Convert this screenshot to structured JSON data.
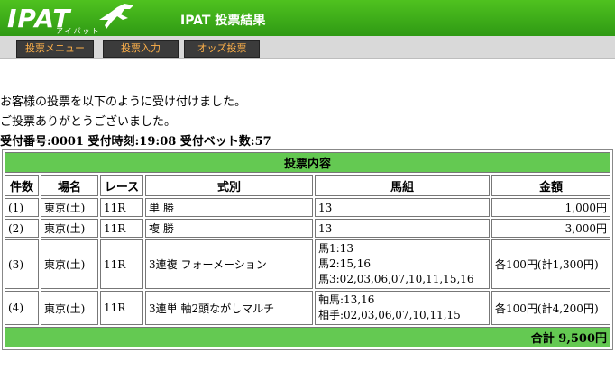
{
  "header": {
    "logo_text": "IPAT",
    "logo_sub": "アイパット",
    "title": "IPAT  投票結果"
  },
  "nav": [
    {
      "label": "投票メニュー"
    },
    {
      "label": "投票入力"
    },
    {
      "label": "オッズ投票"
    }
  ],
  "message": {
    "line1": "お客様の投票を以下のように受け付けました。",
    "line2": "ご投票ありがとうございました。",
    "receipt": "受付番号:0001  受付時刻:19:08  受付ベット数:57"
  },
  "table": {
    "caption": "投票内容",
    "headers": [
      "件数",
      "場名",
      "レース",
      "式別",
      "馬組",
      "金額"
    ],
    "rows": [
      {
        "no": "(1)",
        "venue": "東京(土)",
        "race": "11R",
        "type": "単  勝",
        "combo": [
          "13"
        ],
        "amount": "1,000円"
      },
      {
        "no": "(2)",
        "venue": "東京(土)",
        "race": "11R",
        "type": "複  勝",
        "combo": [
          "13"
        ],
        "amount": "3,000円"
      },
      {
        "no": "(3)",
        "venue": "東京(土)",
        "race": "11R",
        "type": "3連複  フォーメーション",
        "combo": [
          "馬1:13",
          "馬2:15,16",
          "馬3:02,03,06,07,10,11,15,16"
        ],
        "amount": "各100円(計1,300円)"
      },
      {
        "no": "(4)",
        "venue": "東京(土)",
        "race": "11R",
        "type": "3連単  軸2頭ながしマルチ",
        "combo": [
          "軸馬:13,16",
          "相手:02,03,06,07,10,11,15"
        ],
        "amount": "各100円(計4,200円)"
      }
    ],
    "total": "合計 9,500円"
  },
  "colors": {
    "header_green": "#3aa818",
    "band_green": "#64c952",
    "nav_text": "#ffb14a"
  }
}
